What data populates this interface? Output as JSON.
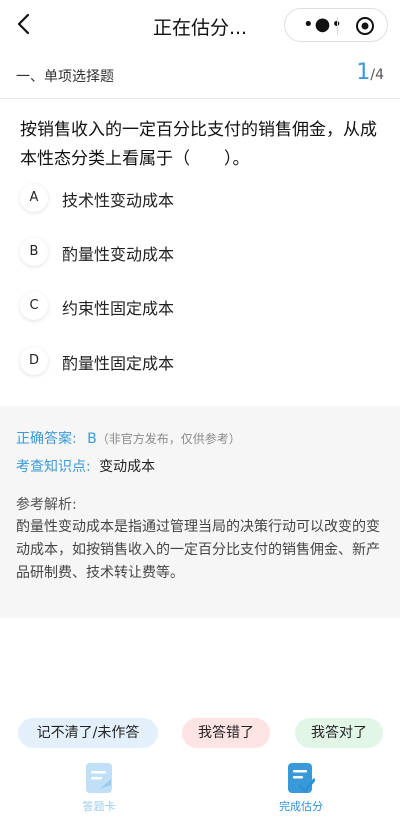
{
  "nav": {
    "title": "正在估分...",
    "back_icon": "chevron-left-icon",
    "more_icon": "more-dots-icon",
    "close_icon": "target-icon"
  },
  "section": {
    "title": "一、单项选择题",
    "current": "1",
    "separator": "/",
    "total": "4"
  },
  "question": {
    "text": "按销售收入的一定百分比支付的销售佣金，从成本性态分类上看属于（　　）。"
  },
  "options": [
    {
      "letter": "A",
      "text": "技术性变动成本"
    },
    {
      "letter": "B",
      "text": "酌量性变动成本"
    },
    {
      "letter": "C",
      "text": "约束性固定成本"
    },
    {
      "letter": "D",
      "text": "酌量性固定成本"
    }
  ],
  "answer": {
    "correct_label": "正确答案:",
    "correct_value": "B",
    "correct_note": "（非官方发布，仅供参考）",
    "knowledge_label": "考查知识点:",
    "knowledge_value": "变动成本",
    "analysis_label": "参考解析:",
    "analysis_text": "酌量性变动成本是指通过管理当局的决策行动可以改变的变动成本，如按销售收入的一定百分比支付的销售佣金、新产品研制费、技术转让费等。"
  },
  "chips": {
    "not_sure": "记不清了/未作答",
    "wrong": "我答错了",
    "right": "我答对了"
  },
  "tabs": {
    "answer_card": "答题卡",
    "finish": "完成估分"
  },
  "colors": {
    "accent": "#3a9ad9",
    "chip_blue": "#e3f0fb",
    "chip_red": "#fde3e3",
    "chip_green": "#e2f6e8"
  }
}
